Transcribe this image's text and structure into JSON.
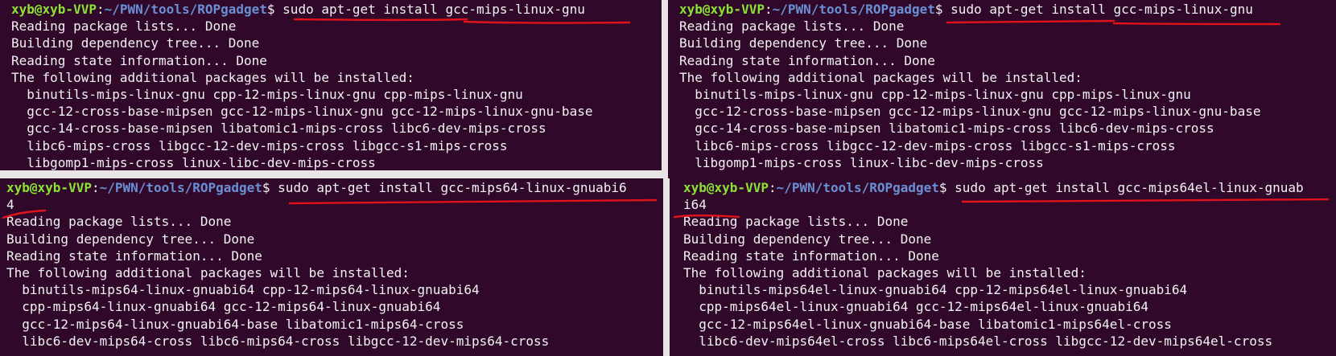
{
  "prompt": {
    "userhost": "xyb@xyb-VVP",
    "colon": ":",
    "path": "~/PWN/tools/ROPgadget",
    "dollar": "$ "
  },
  "colors": {
    "terminal_bg": "#30092a",
    "text": "#f2f2f2",
    "userhost": "#8ae234",
    "path": "#6a8fd4",
    "annotation": "#e0121b"
  },
  "panes": {
    "top_left": {
      "command": "sudo apt-get install gcc-mips-linux-gnu",
      "output": [
        "Reading package lists... Done",
        "Building dependency tree... Done",
        "Reading state information... Done",
        "The following additional packages will be installed:",
        "  binutils-mips-linux-gnu cpp-12-mips-linux-gnu cpp-mips-linux-gnu",
        "  gcc-12-cross-base-mipsen gcc-12-mips-linux-gnu gcc-12-mips-linux-gnu-base",
        "  gcc-14-cross-base-mipsen libatomic1-mips-cross libc6-dev-mips-cross",
        "  libc6-mips-cross libgcc-12-dev-mips-cross libgcc-s1-mips-cross",
        "  libgomp1-mips-cross linux-libc-dev-mips-cross"
      ]
    },
    "top_right": {
      "command": "sudo apt-get install gcc-mips-linux-gnu",
      "output": [
        "Reading package lists... Done",
        "Building dependency tree... Done",
        "Reading state information... Done",
        "The following additional packages will be installed:",
        "  binutils-mips-linux-gnu cpp-12-mips-linux-gnu cpp-mips-linux-gnu",
        "  gcc-12-cross-base-mipsen gcc-12-mips-linux-gnu gcc-12-mips-linux-gnu-base",
        "  gcc-14-cross-base-mipsen libatomic1-mips-cross libc6-dev-mips-cross",
        "  libc6-mips-cross libgcc-12-dev-mips-cross libgcc-s1-mips-cross",
        "  libgomp1-mips-cross linux-libc-dev-mips-cross"
      ]
    },
    "bottom_left": {
      "command": "sudo apt-get install gcc-mips64-linux-gnuabi6",
      "command_wrap": "4",
      "output": [
        "Reading package lists... Done",
        "Building dependency tree... Done",
        "Reading state information... Done",
        "The following additional packages will be installed:",
        "  binutils-mips64-linux-gnuabi64 cpp-12-mips64-linux-gnuabi64",
        "  cpp-mips64-linux-gnuabi64 gcc-12-mips64-linux-gnuabi64",
        "  gcc-12-mips64-linux-gnuabi64-base libatomic1-mips64-cross",
        "  libc6-dev-mips64-cross libc6-mips64-cross libgcc-12-dev-mips64-cross"
      ]
    },
    "bottom_right": {
      "command": "sudo apt-get install gcc-mips64el-linux-gnuab",
      "command_wrap": "i64",
      "output": [
        "Reading package lists... Done",
        "Building dependency tree... Done",
        "Reading state information... Done",
        "The following additional packages will be installed:",
        "  binutils-mips64el-linux-gnuabi64 cpp-12-mips64el-linux-gnuabi64",
        "  cpp-mips64el-linux-gnuabi64 gcc-12-mips64el-linux-gnuabi64",
        "  gcc-12-mips64el-linux-gnuabi64-base libatomic1-mips64el-cross",
        "  libc6-dev-mips64el-cross libc6-mips64el-cross libgcc-12-dev-mips64el-cross"
      ]
    }
  }
}
